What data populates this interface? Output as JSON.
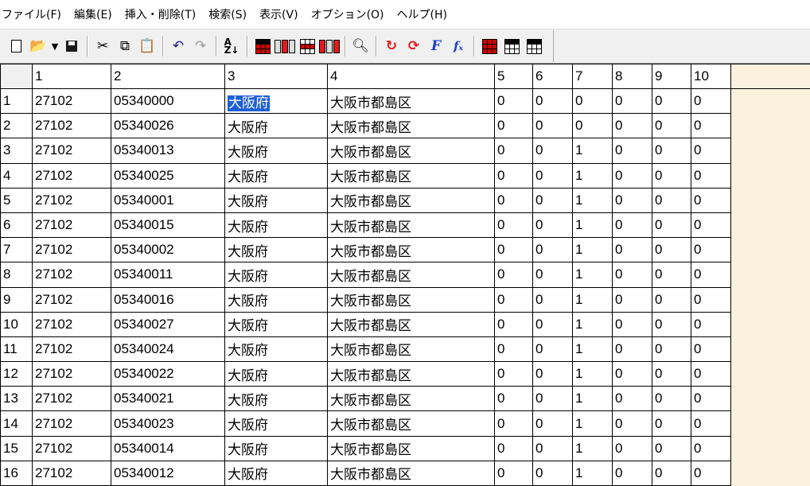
{
  "menu": [
    {
      "label": "ファイル(F)"
    },
    {
      "label": "編集(E)"
    },
    {
      "label": "挿入・削除(T)"
    },
    {
      "label": "検索(S)"
    },
    {
      "label": "表示(V)"
    },
    {
      "label": "オプション(O)"
    },
    {
      "label": "ヘルプ(H)"
    }
  ],
  "toolbar": {
    "icons": [
      "new-file-icon",
      "open-folder-icon",
      "dropdown-arrow-icon",
      "save-icon",
      "cut-icon",
      "copy-icon",
      "paste-icon",
      "undo-icon",
      "redo-icon",
      "sort-icon",
      "insert-row-icon",
      "insert-column-icon",
      "delete-row-icon",
      "delete-column-icon",
      "find-icon",
      "recalc-icon",
      "recalc-all-icon",
      "font-icon",
      "function-icon",
      "grid-red-icon",
      "grid-header-icon",
      "grid-icon"
    ]
  },
  "grid": {
    "columns": [
      "1",
      "2",
      "3",
      "4",
      "5",
      "6",
      "7",
      "8",
      "9",
      "10"
    ],
    "selected_cell": {
      "row": 0,
      "col": 2
    },
    "filler_color": "#fbf1dd",
    "selection_color": "#1f5fd6",
    "rows": [
      {
        "num": "1",
        "cells": [
          "27102",
          "05340000",
          "大阪府",
          "大阪市都島区",
          "0",
          "0",
          "0",
          "0",
          "0",
          "0"
        ]
      },
      {
        "num": "2",
        "cells": [
          "27102",
          "05340026",
          "大阪府",
          "大阪市都島区",
          "0",
          "0",
          "0",
          "0",
          "0",
          "0"
        ]
      },
      {
        "num": "3",
        "cells": [
          "27102",
          "05340013",
          "大阪府",
          "大阪市都島区",
          "0",
          "0",
          "1",
          "0",
          "0",
          "0"
        ]
      },
      {
        "num": "4",
        "cells": [
          "27102",
          "05340025",
          "大阪府",
          "大阪市都島区",
          "0",
          "0",
          "1",
          "0",
          "0",
          "0"
        ]
      },
      {
        "num": "5",
        "cells": [
          "27102",
          "05340001",
          "大阪府",
          "大阪市都島区",
          "0",
          "0",
          "1",
          "0",
          "0",
          "0"
        ]
      },
      {
        "num": "6",
        "cells": [
          "27102",
          "05340015",
          "大阪府",
          "大阪市都島区",
          "0",
          "0",
          "1",
          "0",
          "0",
          "0"
        ]
      },
      {
        "num": "7",
        "cells": [
          "27102",
          "05340002",
          "大阪府",
          "大阪市都島区",
          "0",
          "0",
          "1",
          "0",
          "0",
          "0"
        ]
      },
      {
        "num": "8",
        "cells": [
          "27102",
          "05340011",
          "大阪府",
          "大阪市都島区",
          "0",
          "0",
          "1",
          "0",
          "0",
          "0"
        ]
      },
      {
        "num": "9",
        "cells": [
          "27102",
          "05340016",
          "大阪府",
          "大阪市都島区",
          "0",
          "0",
          "1",
          "0",
          "0",
          "0"
        ]
      },
      {
        "num": "10",
        "cells": [
          "27102",
          "05340027",
          "大阪府",
          "大阪市都島区",
          "0",
          "0",
          "1",
          "0",
          "0",
          "0"
        ]
      },
      {
        "num": "11",
        "cells": [
          "27102",
          "05340024",
          "大阪府",
          "大阪市都島区",
          "0",
          "0",
          "1",
          "0",
          "0",
          "0"
        ]
      },
      {
        "num": "12",
        "cells": [
          "27102",
          "05340022",
          "大阪府",
          "大阪市都島区",
          "0",
          "0",
          "1",
          "0",
          "0",
          "0"
        ]
      },
      {
        "num": "13",
        "cells": [
          "27102",
          "05340021",
          "大阪府",
          "大阪市都島区",
          "0",
          "0",
          "1",
          "0",
          "0",
          "0"
        ]
      },
      {
        "num": "14",
        "cells": [
          "27102",
          "05340023",
          "大阪府",
          "大阪市都島区",
          "0",
          "0",
          "1",
          "0",
          "0",
          "0"
        ]
      },
      {
        "num": "15",
        "cells": [
          "27102",
          "05340014",
          "大阪府",
          "大阪市都島区",
          "0",
          "0",
          "1",
          "0",
          "0",
          "0"
        ]
      },
      {
        "num": "16",
        "cells": [
          "27102",
          "05340012",
          "大阪府",
          "大阪市都島区",
          "0",
          "0",
          "1",
          "0",
          "0",
          "0"
        ]
      }
    ]
  }
}
